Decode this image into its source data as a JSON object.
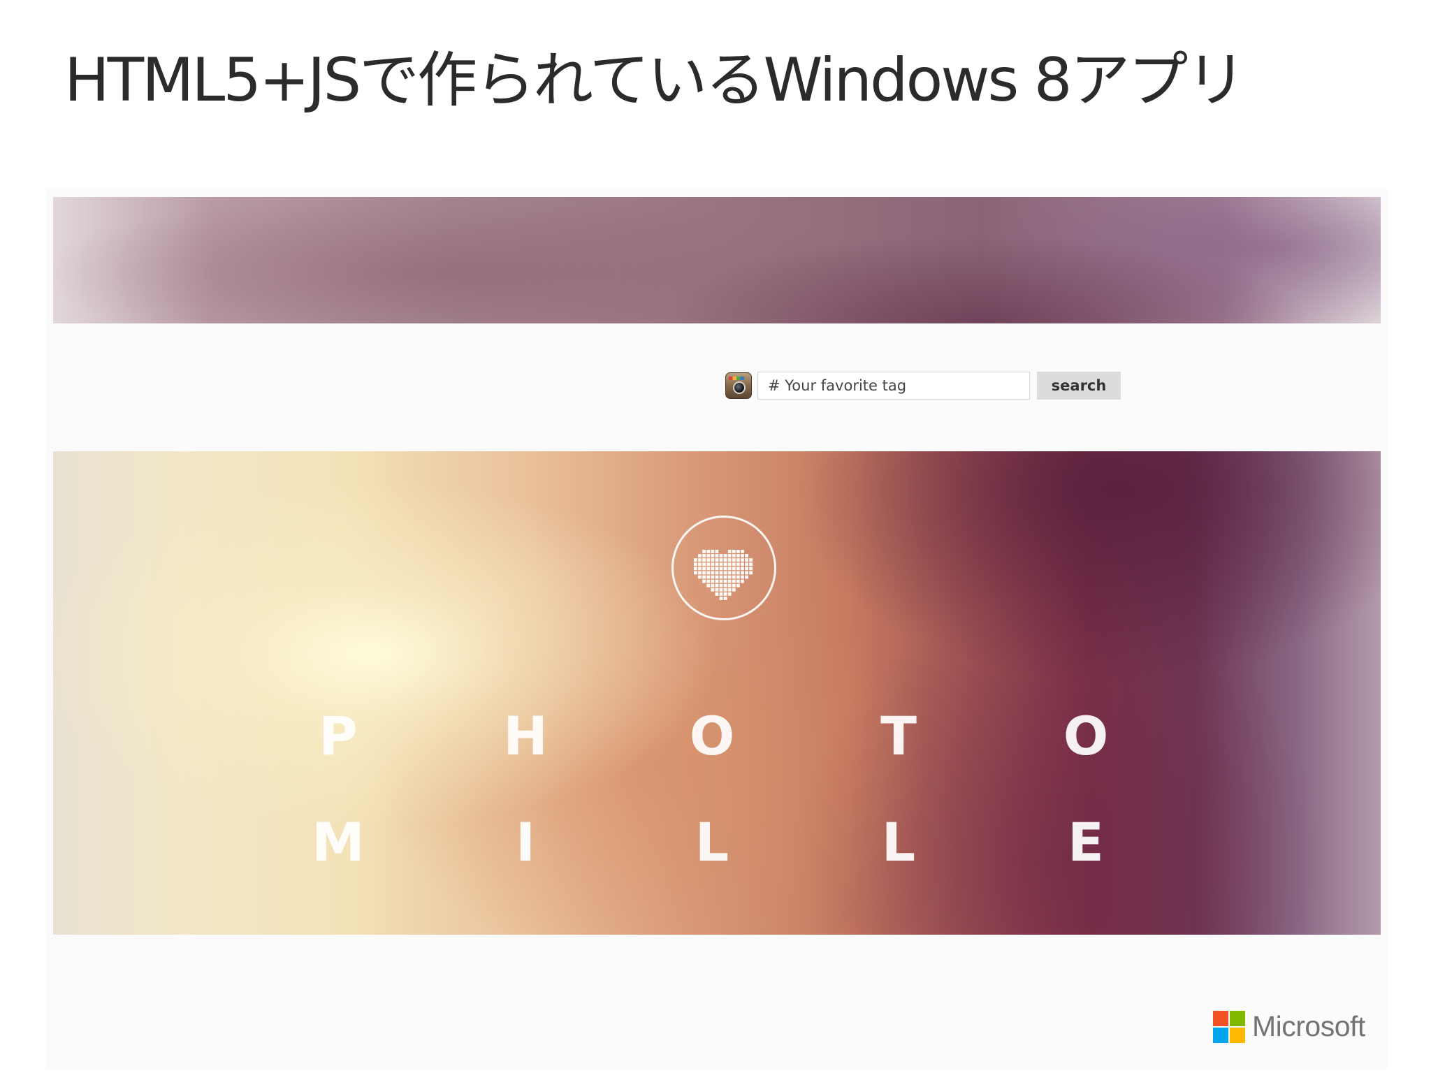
{
  "slide": {
    "title": "HTML5+JSで作られているWindows 8アプリ"
  },
  "app": {
    "search": {
      "icon": "instagram-camera-icon",
      "placeholder": "# Your favorite tag",
      "button_label": "search"
    },
    "hero": {
      "icon": "pixel-heart-icon",
      "letters_row1": [
        "P",
        "H",
        "O",
        "T",
        "O"
      ],
      "letters_row2": [
        "M",
        "I",
        "L",
        "L",
        "E"
      ]
    }
  },
  "branding": {
    "logo_icon": "microsoft-windows-logo-icon",
    "wordmark": "Microsoft",
    "colors": [
      "#f25022",
      "#7fba00",
      "#00a4ef",
      "#ffb900"
    ]
  }
}
